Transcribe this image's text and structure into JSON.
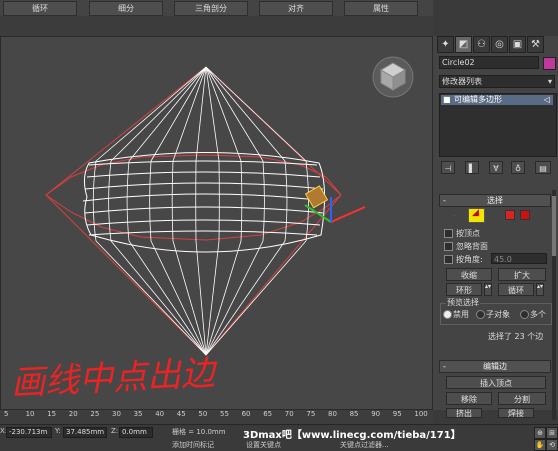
{
  "tabs": [
    "循环",
    "细分",
    "三角剖分",
    "对齐",
    "属性"
  ],
  "object_name": "Circle02",
  "modifier_list": "修改器列表",
  "stack_item": "可编辑多边形",
  "rollouts": {
    "selection": {
      "title": "选择",
      "by_vertex": "按顶点",
      "ignore_backfacing": "忽略背面",
      "by_angle": "按角度:",
      "angle_value": "45.0",
      "shrink": "收缩",
      "grow": "扩大",
      "ring": "环形",
      "loop": "循环",
      "preview_title": "预览选择",
      "preview_off": "禁用",
      "preview_subobj": "子对象",
      "preview_multi": "多个",
      "status": "选择了 23 个边"
    },
    "edit_edges": {
      "title": "编辑边",
      "insert_vertex": "插入顶点",
      "remove": "移除",
      "split": "分割",
      "extrude": "挤出",
      "weld": "焊接"
    }
  },
  "ruler_ticks": [
    "5",
    "10",
    "15",
    "20",
    "25",
    "30",
    "35",
    "40",
    "45",
    "50",
    "55",
    "60",
    "65",
    "70",
    "75",
    "80",
    "85",
    "90",
    "95",
    "100"
  ],
  "status_bar": {
    "x_label": "X:",
    "x_value": "-230.713m",
    "y_label": "Y:",
    "y_value": "37.485mm",
    "z_label": "Z:",
    "z_value": "0.0mm",
    "grid": "栅格 = 10.0mm",
    "add_tag": "添加时间标记",
    "set_key": "设置关键点",
    "key_filter": "关键点过滤器..."
  },
  "handwriting": "画线中点出边",
  "watermark": "3Dmax吧【www.linecg.com/tieba/171】",
  "colors": {
    "viewport_bg": "#474747",
    "wire_selected": "#d94040",
    "wire": "#ffffff",
    "handwriting": "#ff2020",
    "object_color": "#c0399a"
  }
}
